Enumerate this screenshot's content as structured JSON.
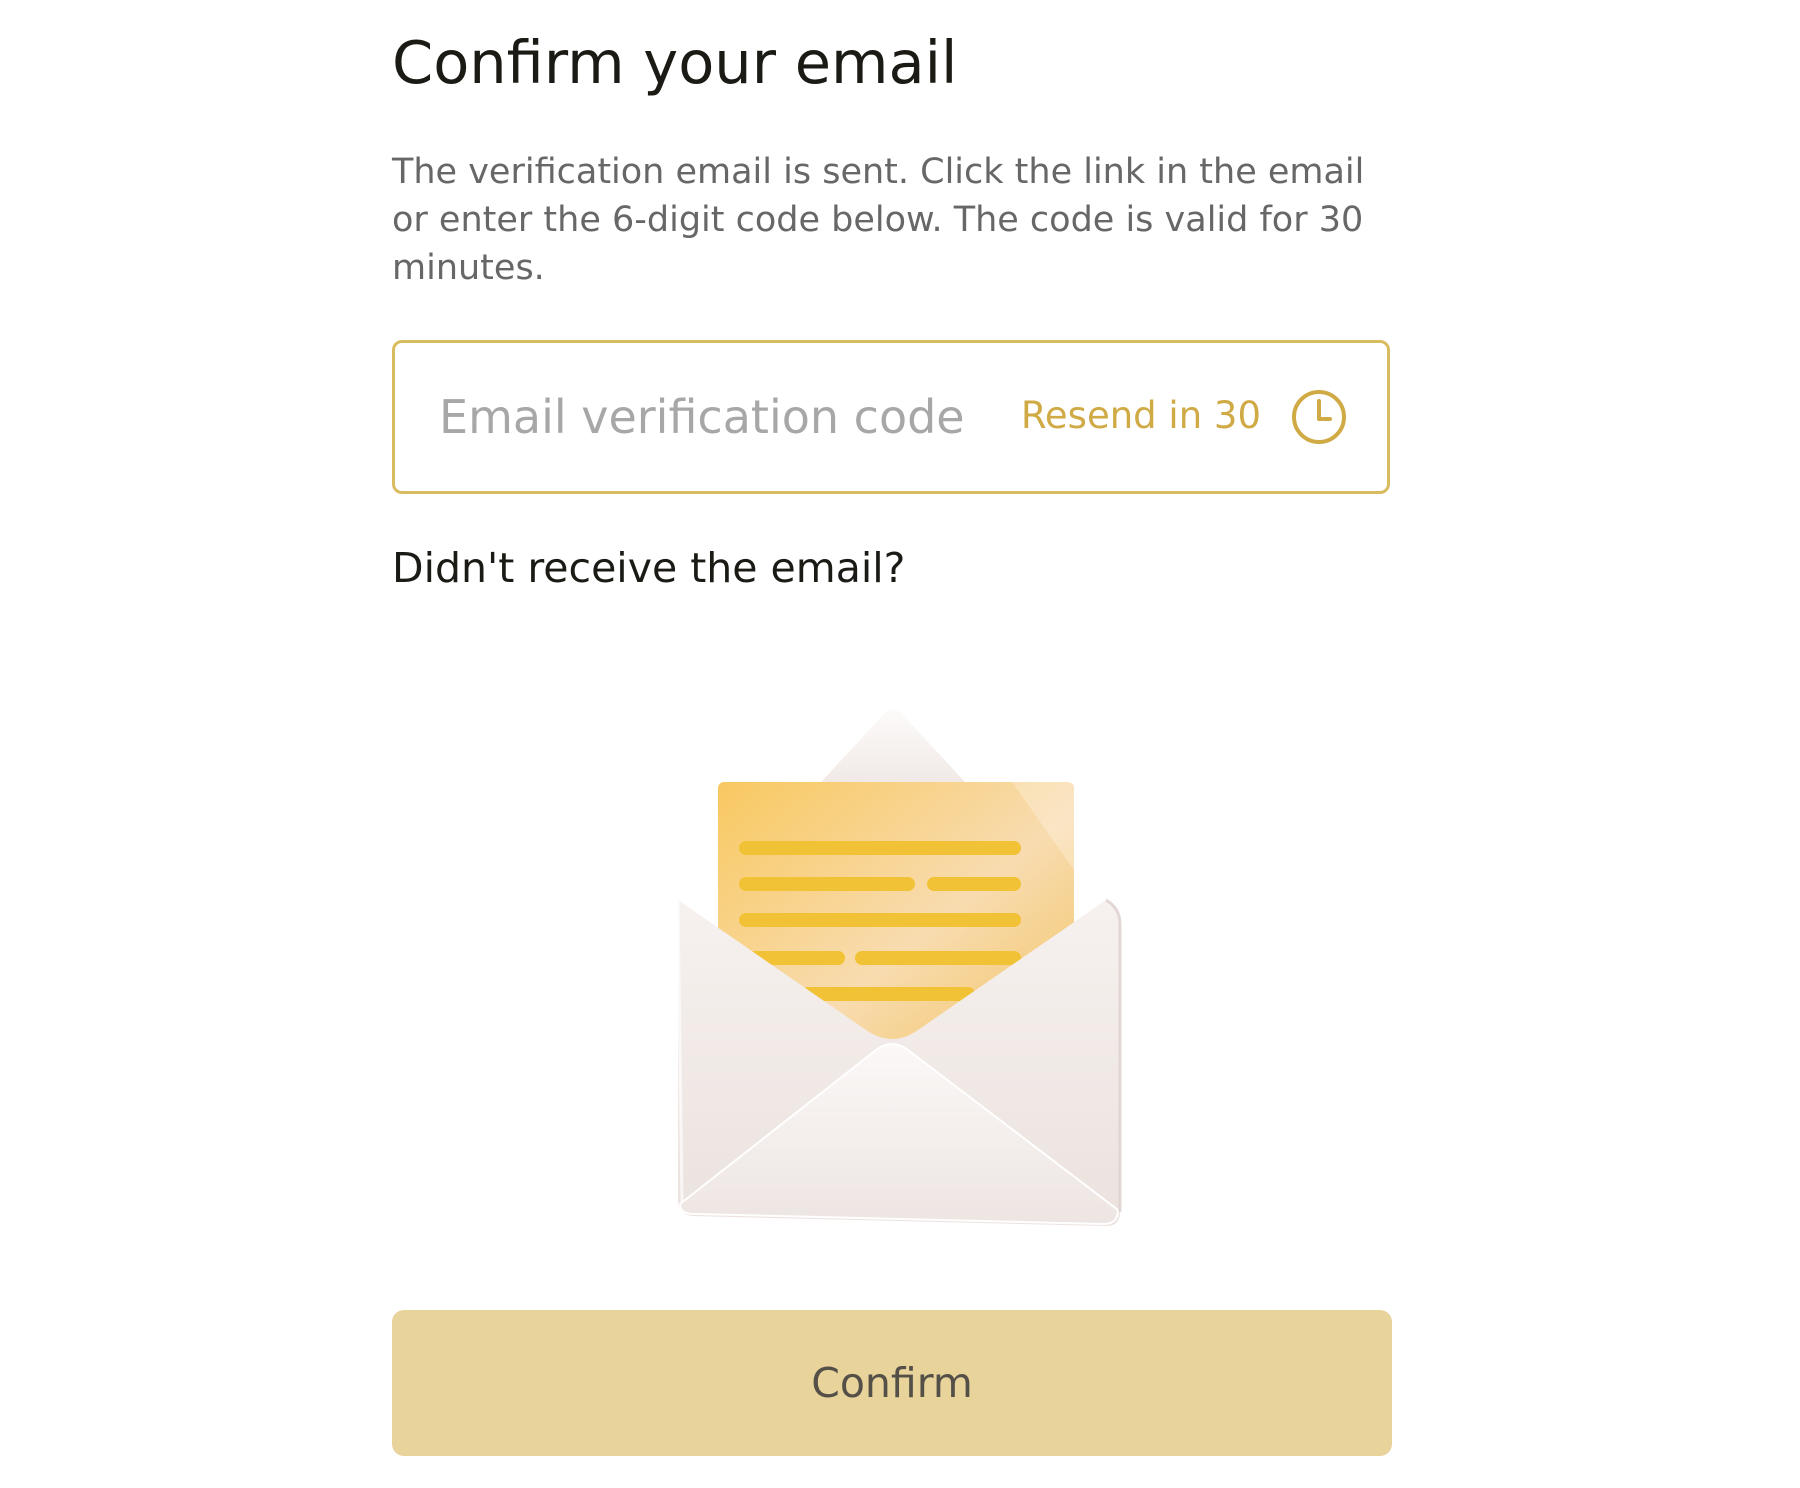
{
  "page": {
    "title": "Confirm your email",
    "description": "The verification email is sent. Click the link in the email or enter the 6-digit code below. The code is valid for 30 minutes."
  },
  "code_field": {
    "placeholder": "Email verification code",
    "value": "",
    "resend_label": "Resend in 30",
    "icon": "clock-icon"
  },
  "help": {
    "question": "Didn't receive the email?"
  },
  "illustration": {
    "icon": "open-envelope-with-letter",
    "colors": {
      "envelope": "#f3ece9",
      "letter": "#f6cf7e",
      "lines": "#f2c236"
    }
  },
  "actions": {
    "confirm_label": "Confirm"
  },
  "colors": {
    "accent": "#d9bc5f",
    "accent_text": "#cfaa45",
    "button_bg": "#e8d49b",
    "button_text": "#545048",
    "heading": "#1b1a15",
    "body_text": "#676767",
    "placeholder": "#a7a7a7"
  }
}
